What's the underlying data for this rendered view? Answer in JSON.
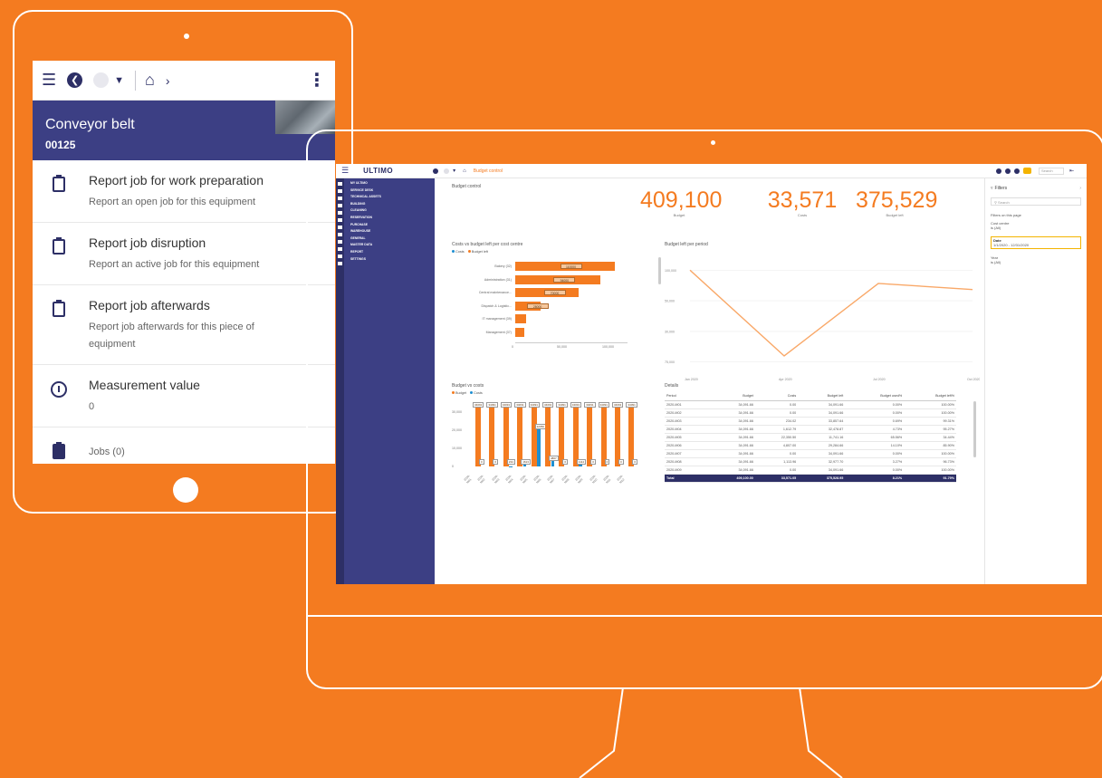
{
  "tablet": {
    "title": "Conveyor belt",
    "code": "00125",
    "actions": [
      {
        "title": "Report job for work preparation",
        "subtitle": "Report an open job for this equipment"
      },
      {
        "title": "Report job disruption",
        "subtitle": "Report an active job for this equipment"
      },
      {
        "title": "Report job afterwards",
        "subtitle": "Report job afterwards for this piece of equipment"
      },
      {
        "title": "Measurement value",
        "subtitle": "0"
      }
    ],
    "jobs_label": "Jobs (0)"
  },
  "app": {
    "logo": "ULTIMO",
    "breadcrumb": "Budget control",
    "user": "Search",
    "nav": [
      "MY ULTIMO",
      "SERVICE DESK",
      "TECHNICAL ASSETS",
      "BUILDING",
      "CLEANING",
      "RESERVATION",
      "PURCHASE",
      "WAREHOUSE",
      "GENERAL",
      "MASTER DATA",
      "REPORT",
      "SETTINGS"
    ],
    "page_title": "Budget control",
    "kpis": [
      {
        "value": "409,100",
        "label": "Budget"
      },
      {
        "value": "33,571",
        "label": "Costs"
      },
      {
        "value": "375,529",
        "label": "Budget left"
      }
    ],
    "sections": {
      "cost_centre": "Costs vs budget left per cost centre",
      "per_period": "Budget left per period",
      "budget_vs_costs": "Budget vs costs",
      "details": "Details"
    },
    "legends": {
      "costs": "Costs",
      "budget_left": "Budget left",
      "budget": "Budget"
    },
    "filters": {
      "title": "Filters",
      "search": "Search",
      "section": "Filters on this page",
      "items": [
        {
          "name": "Cost centre",
          "value": "is (All)"
        },
        {
          "name": "Date",
          "value": "1/1/2020 - 12/31/2020"
        },
        {
          "name": "Year",
          "value": "is (All)"
        }
      ]
    }
  },
  "chart_data": [
    {
      "type": "bar",
      "orientation": "horizontal",
      "title": "Costs vs budget left per cost centre",
      "categories": [
        "Bakery (32)",
        "Administration (31)",
        "Central maintenance...",
        "Dispatch & Logistic...",
        "IT management (39)",
        "Management (37)"
      ],
      "series": [
        {
          "name": "Costs",
          "values": [
            0,
            0,
            0,
            0,
            0,
            0
          ]
        },
        {
          "name": "Budget left",
          "values": [
            110000,
            94000,
            70000,
            28000,
            12000,
            10000
          ]
        }
      ],
      "tags": [
        "110000",
        "94000",
        "70000",
        "28000",
        "",
        ""
      ],
      "xticks": [
        "0",
        "50,000",
        "100,000"
      ],
      "xlim": [
        0,
        120000
      ]
    },
    {
      "type": "line",
      "title": "Budget left per period",
      "x": [
        "Jan 2020",
        "Apr 2020",
        "Jul 2020",
        "Oct 2020"
      ],
      "series": [
        {
          "name": "Budget left",
          "values": [
            100000,
            16000,
            87000,
            81000
          ]
        }
      ],
      "yticks": [
        "100,000",
        "50,000",
        "30,000",
        "75,000"
      ],
      "ylim": [
        0,
        110000
      ],
      "grid": true
    },
    {
      "type": "bar",
      "title": "Budget vs costs",
      "categories": [
        "2020-M01",
        "2020-M02",
        "2020-M03",
        "2020-M04",
        "2020-M05",
        "2020-M06",
        "2020-M07",
        "2020-M08",
        "2020-M09",
        "2020-M10",
        "2020-M11",
        "2020-M12"
      ],
      "series": [
        {
          "name": "Budget",
          "values": [
            34091,
            34091,
            34091,
            34091,
            34091,
            34091,
            34091,
            34091,
            34091,
            34091,
            34091,
            34091
          ]
        },
        {
          "name": "Costs",
          "values": [
            0,
            0,
            234,
            1613,
            22350,
            4807,
            0,
            1114,
            0,
            0,
            0,
            0
          ]
        }
      ],
      "budget_tags": [
        "34091",
        "34091",
        "34091",
        "34091",
        "34091",
        "34091",
        "34091",
        "34091",
        "34091",
        "34091",
        "34091",
        "34091"
      ],
      "cost_tags": [
        "0",
        "0",
        "234",
        "1613",
        "22350",
        "4807",
        "0",
        "1114",
        "0",
        "0",
        "0",
        "0"
      ],
      "yticks": [
        "30,000",
        "20,000",
        "10,000",
        "0"
      ],
      "ylim": [
        0,
        36000
      ]
    }
  ],
  "table": {
    "columns": [
      "Period",
      "Budget",
      "Costs",
      "Budget left",
      "Budget used%",
      "Budget left%"
    ],
    "rows": [
      [
        "2020-M01",
        "34,091.66",
        "0.00",
        "34,091.66",
        "0.00%",
        "100.00%"
      ],
      [
        "2020-M02",
        "34,091.66",
        "0.00",
        "34,091.66",
        "0.00%",
        "100.00%"
      ],
      [
        "2020-M03",
        "34,091.66",
        "234.02",
        "33,857.64",
        "0.69%",
        "99.31%"
      ],
      [
        "2020-M04",
        "34,091.66",
        "1,612.79",
        "32,478.87",
        "4.73%",
        "95.27%"
      ],
      [
        "2020-M05",
        "34,091.66",
        "22,350.50",
        "11,741.16",
        "65.56%",
        "34.44%"
      ],
      [
        "2020-M06",
        "34,091.66",
        "4,807.00",
        "29,284.66",
        "14.10%",
        "85.90%"
      ],
      [
        "2020-M07",
        "34,091.66",
        "0.00",
        "34,091.66",
        "0.00%",
        "100.00%"
      ],
      [
        "2020-M08",
        "34,091.66",
        "1,113.96",
        "32,977.70",
        "3.27%",
        "96.73%"
      ],
      [
        "2020-M09",
        "34,091.66",
        "0.00",
        "34,091.66",
        "0.00%",
        "100.00%"
      ]
    ],
    "total": [
      "Total",
      "409,100.00",
      "33,571.05",
      "375,528.95",
      "8.21%",
      "91.79%"
    ]
  }
}
